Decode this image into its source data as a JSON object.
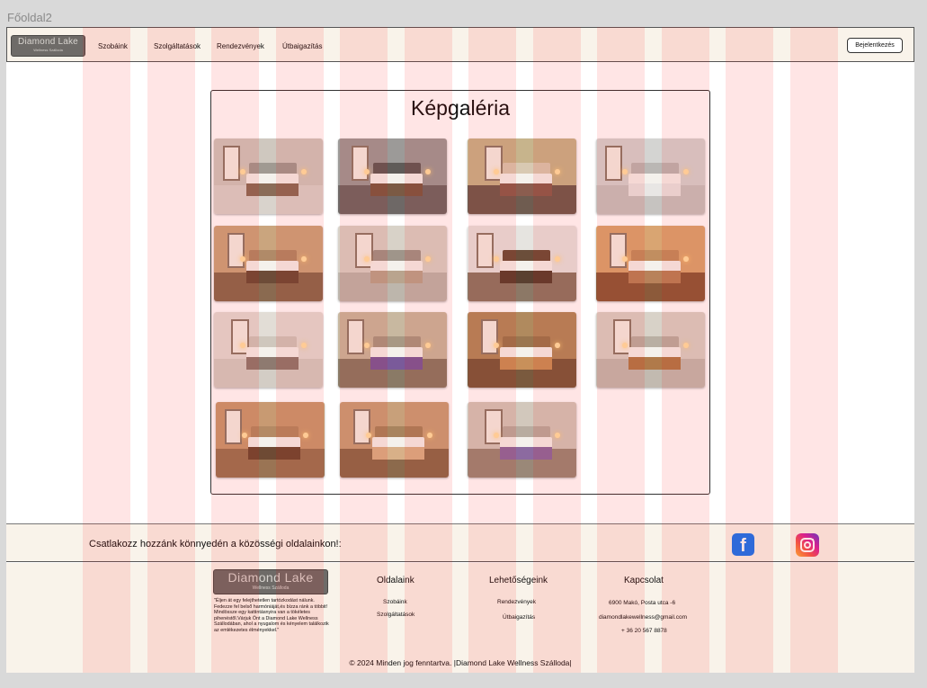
{
  "frame_label": "Főoldal2",
  "header": {
    "logo_main": "Diamond Lake",
    "logo_sub": "Wellness Szálloda",
    "nav": [
      "Szobáink",
      "Szolgáltatások",
      "Rendezvények",
      "Útbaigazítás"
    ],
    "login_label": "Bejelentkezés"
  },
  "gallery": {
    "title": "Képgaléria",
    "photos": [
      {
        "wall": "#cfc8bf",
        "floor": "#d9d3cc",
        "blanket": "#8a6c58",
        "head": "#a09a92"
      },
      {
        "wall": "#9c9a98",
        "floor": "#6e6866",
        "blanket": "#7b5a44",
        "head": "#5f5b58"
      },
      {
        "wall": "#c7b48c",
        "floor": "#6f5c50",
        "blanket": "#8b5d4f",
        "head": "#d8c9b2"
      },
      {
        "wall": "#d4d4d2",
        "floor": "#c6c3c0",
        "blanket": "#e8e6e4",
        "head": "#bab7b4"
      },
      {
        "wall": "#caa57e",
        "floor": "#8a6a50",
        "blanket": "#6d4c38",
        "head": "#b08a68"
      },
      {
        "wall": "#d8d2c8",
        "floor": "#bdb6ac",
        "blanket": "#b9a48e",
        "head": "#9f958a"
      },
      {
        "wall": "#e6e4e0",
        "floor": "#8c7866",
        "blanket": "#5a4030",
        "head": "#6b4e3a"
      },
      {
        "wall": "#d9a572",
        "floor": "#8c5a3a",
        "blanket": "#b8825a",
        "head": "#c18e60"
      },
      {
        "wall": "#e2ddd6",
        "floor": "#d3cdc5",
        "blanket": "#8e7a70",
        "head": "#cfc7bd"
      },
      {
        "wall": "#c8b8a0",
        "floor": "#8a7a66",
        "blanket": "#7a5a9a",
        "head": "#a89884"
      },
      {
        "wall": "#b08a5e",
        "floor": "#7a5a3e",
        "blanket": "#c8905a",
        "head": "#9a7650"
      },
      {
        "wall": "#d8d2c8",
        "floor": "#c2bab0",
        "blanket": "#b07a4a",
        "head": "#b9afa3"
      },
      {
        "wall": "#c89a72",
        "floor": "#9a7454",
        "blanket": "#6e4a34",
        "head": "#b48a64"
      },
      {
        "wall": "#c8a07a",
        "floor": "#8c6a4c",
        "blanket": "#d8b088",
        "head": "#a8845e"
      },
      {
        "wall": "#d2c8bc",
        "floor": "#9a8878",
        "blanket": "#8c6aa0",
        "head": "#b8aca0"
      }
    ]
  },
  "social": {
    "text": "Csatlakozz hozzánk könnyedén a közösségi oldalainkon!:",
    "facebook_icon": "facebook-icon",
    "instagram_icon": "instagram-icon"
  },
  "footer": {
    "logo_main": "Diamond Lake",
    "logo_sub": "Wellness Szálloda",
    "description": "\"Éljen át egy felejthetetlen tartózkodást nálunk. Fedezze fel belső harmóniáját,és bízza ránk a többit! Mindössze egy kattintásnyira van a tökéletes pihenéstől.Várjuk Önt a Diamond Lake Wellness Szállodában, ahol a nyugalom és kényelem találkozik az emlékezetes élményekkel.\"",
    "col1": {
      "title": "Oldalaink",
      "items": [
        "Szobáink",
        "Szolgáltatások"
      ]
    },
    "col2": {
      "title": "Lehetőségeink",
      "items": [
        "Rendezvények",
        "Útbaigazítás"
      ]
    },
    "col3": {
      "title": "Kapcsolat",
      "items": [
        "6900 Makó, Posta  utca -6",
        "diamondlakewellness@gmail.com",
        "+ 36 20 567 8878"
      ]
    },
    "copyright": "© 2024 Minden jog fenntartva. |Diamond Lake Wellness Szálloda|"
  }
}
